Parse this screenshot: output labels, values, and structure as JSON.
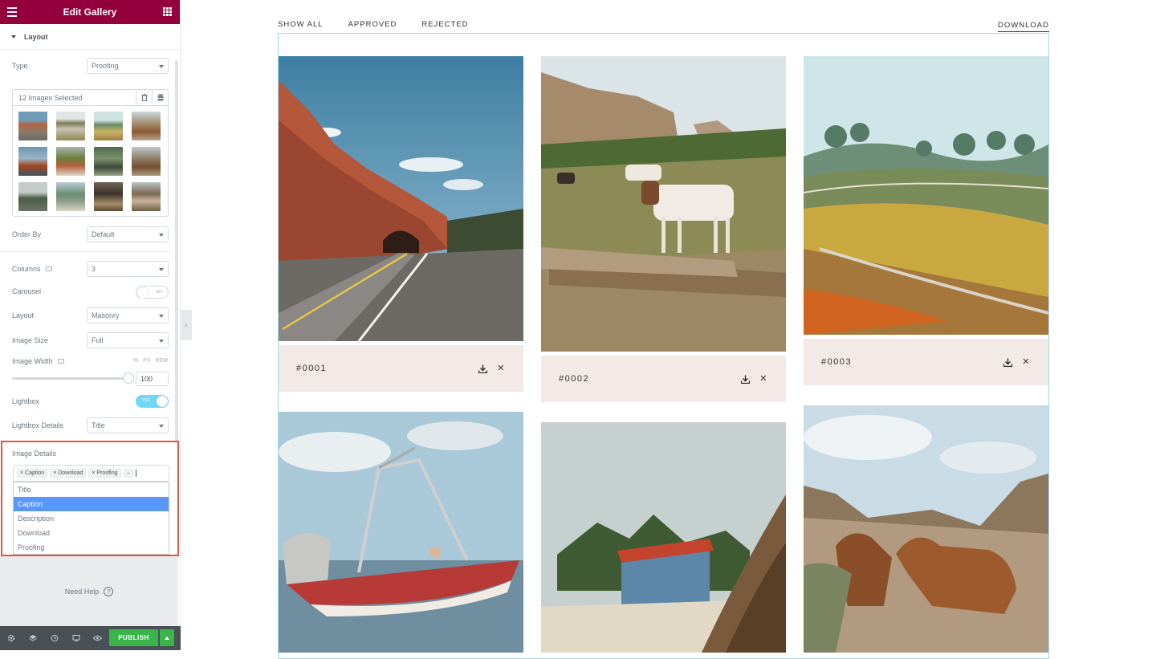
{
  "panel": {
    "title": "Edit Gallery",
    "section": "Layout",
    "type_label": "Type",
    "type_value": "Proofing",
    "gallery_count": "12 Images Selected",
    "order_label": "Order By",
    "order_value": "Default",
    "columns_label": "Columns",
    "columns_value": "3",
    "carousel_label": "Carousel",
    "carousel_toggle": "NO",
    "layout_label": "Layout",
    "layout_value": "Masonry",
    "image_size_label": "Image Size",
    "image_size_value": "Full",
    "image_width_label": "Image Width",
    "image_width_value": "100",
    "units": [
      "%",
      "PX",
      "REM"
    ],
    "lightbox_label": "Lightbox",
    "lightbox_toggle": "YES",
    "lightbox_details_label": "Lightbox Details",
    "lightbox_details_value": "Title",
    "image_details_label": "Image Details",
    "image_details_tags": [
      "Caption",
      "Download",
      "Proofing"
    ],
    "dropdown_options": [
      "Title",
      "Caption",
      "Description",
      "Download",
      "Proofing"
    ],
    "dropdown_highlighted": "Caption",
    "help": "Need Help",
    "publish": "PUBLISH"
  },
  "preview": {
    "filters": [
      "SHOW ALL",
      "APPROVED",
      "REJECTED"
    ],
    "download": "DOWNLOAD",
    "cards": [
      {
        "caption": "#0001"
      },
      {
        "caption": "#0002"
      },
      {
        "caption": "#0003"
      }
    ]
  },
  "colors": {
    "header": "#93003c",
    "publish": "#39b54a",
    "caption_bg": "#f3e9e6",
    "highlight": "#5897fb",
    "outline": "#e25640"
  }
}
